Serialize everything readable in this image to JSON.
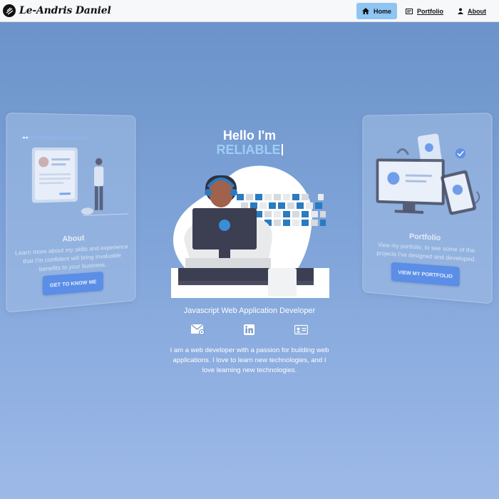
{
  "nav": {
    "brand": "Le-Andris Daniel",
    "links": [
      {
        "label": "Home",
        "icon": "home-icon",
        "active": true
      },
      {
        "label": "Portfolio",
        "icon": "portfolio-icon",
        "active": false
      },
      {
        "label": "About",
        "icon": "user-icon",
        "active": false
      }
    ]
  },
  "hero": {
    "greeting": "Hello I'm",
    "role": "RELIABLE",
    "subtitle": "Javascript Web Application Developer",
    "bio": "I am a web developer with a passion for building web applications. I love to learn new technologies, and I love learning new technologies.",
    "socials": [
      "email-icon",
      "linkedin-icon",
      "contact-card-icon"
    ]
  },
  "about_card": {
    "title": "About",
    "text": "Learn more about my skills and experience that I'm confident will bring invaluable benefits to your business.",
    "button": "GET TO KNOW ME"
  },
  "portfolio_card": {
    "title": "Portfolio",
    "text": "View my portfolio, to see some of the projects I've designed and developed.",
    "button": "VIEW MY PORTFOLIO"
  },
  "colors": {
    "accent": "#8ec5f3",
    "role_text": "#9ecdf6",
    "card_button": "#5b8ee6",
    "background_top": "#6a92c8",
    "background_bottom": "#9db9e8"
  }
}
